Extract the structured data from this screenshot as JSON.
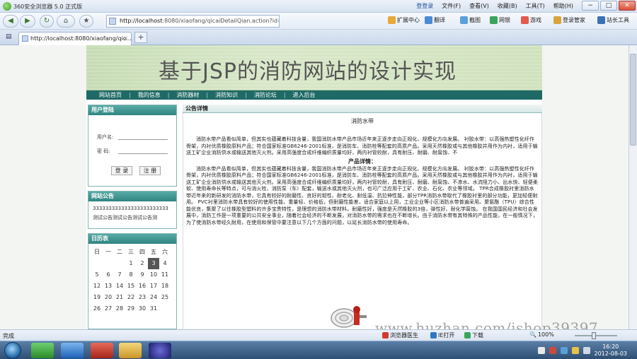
{
  "browser": {
    "app_title": "360安全浏览器 5.0 正式版",
    "menu": [
      "文件(F)",
      "查看(V)",
      "收藏(B)",
      "工具(T)",
      "帮助(H)"
    ],
    "login_link": "登登录",
    "window_controls": [
      "−",
      "□",
      "✕"
    ]
  },
  "nav": {
    "back": "◀",
    "forward": "▶",
    "refresh": "↻",
    "home": "⌂",
    "fav": "★",
    "address_host": "http://localhost",
    "address_rest": ":8080/xiaofang/qicaiDetailQian.action?id=4",
    "toolbar": [
      "扩展中心",
      "翻译",
      "截图",
      "网银",
      "游戏",
      "登录管家",
      "站长工具"
    ]
  },
  "tab": {
    "label": "http://localhost:8080/xiaofang/qic...",
    "close": "×",
    "new": "+"
  },
  "site": {
    "banner_title": "基于JSP的消防网站的设计实现",
    "nav": [
      "网站首页",
      "我的信息",
      "消防器材",
      "消防知识",
      "消防论坛",
      "进入后台"
    ],
    "login": {
      "header": "用户登陆",
      "user_label": "用户名:",
      "pass_label": "密 码:",
      "login_btn": "登 录",
      "register_btn": "注 册"
    },
    "notice": {
      "header": "网站公告",
      "lines": [
        "333333333333333333333333",
        "测试公告测试公告测试公告测"
      ]
    },
    "calendar": {
      "header": "日历表",
      "weekdays": [
        "日",
        "一",
        "二",
        "三",
        "四",
        "五",
        "六"
      ],
      "days": [
        "",
        "",
        "",
        "",
        "",
        "",
        "",
        "",
        "",
        "",
        "1",
        "2",
        "3",
        "4",
        "5",
        "6",
        "7",
        "8",
        "9",
        "10",
        "11",
        "12",
        "13",
        "14",
        "15",
        "16",
        "17",
        "18",
        "19",
        "20",
        "21",
        "22",
        "23",
        "24",
        "25",
        "26",
        "27",
        "28",
        "29",
        "30",
        "31",
        "",
        ""
      ],
      "today": "3"
    },
    "main": {
      "header": "公告详情",
      "article_title": "消防水带",
      "para1": "消防水带产品看似简单，但其实也蕴藏着科技含量，我国消防水带产品市场近年来正逐步走向正规化、规模化方向发展。 衬胶水带：以高强热塑性化纤作骨架，内衬优质橡胶原料产品；符合国家标准GB6246-2001标准，是消防车、消防栓等配套的高质产品。采用天然橡胶或与其他橡胶并用作为内衬，适用于输送工矿企业消防供水或输送其他灭火剂。采用高强度合成纤维编织质量均好，两内衬管较耐，具有耐压、耐磨、耐腐蚀、不",
      "subhead": "产品详情：",
      "para2": "消防水带产品看似简单，但其实也蕴藏着科技含量，我国消防水带产品市场近年来正逐步走向正规化、规模化方向发展。 衬胶水带：以高强热塑性化纤作骨架，内衬优质橡胶原料产品；符合国家标准GB6246-2001标准，是消防车、消防栓等配套的高质产品。采用天然橡胶或与其他橡胶并用作为内衬，适用于输送工矿企业消防供水或输送其他灭火剂。采用高强度合成纤维编织质量均好，两内衬管较耐，具有耐压、耐磨、耐腐蚀、不渗水、水流阻力小、出水快、轻便柔软、使用寿命长等特点，可与消火栓、消防泵（车）配套，输送水或其他灭火剂，也可广泛应用于工矿、农业、石化、农业等领域。 TPR合成橡胶衬里消防水带近年来的新研发的消防水带，它具有较好的耐磨性、良好的韧性、耐老化、耐低温、抗拉伸性能，部分TPR消防水带取代了橡胶衬里的部分功能，更加轻便耐用。 PVC衬里消防水带具有较好的使用性能、重量轻、价格低，但耐磨性能差，适合家庭以上用，工业企业等小区消防水带普遍采用。聚氨酯（TPU）综合性能优良，集聚了以往橡胶型塑料的许多宝贵特性，是理想的消防水带材料。耐磨性好，强度是天然橡胶的3倍，弹性好、耐化学腐蚀。 在我国国民经济和社会发展中，消防工作是一项重要的公共安全事业，随着社会经济的不断发展，对消防水带的需求也在不断增长。由于消防水带有其特殊的产品性能，在一般情况下，为了使消防水带经久耐用，在使用和保管中要注意以下几个方面的问题，以延长消防水带的使用寿命。"
    }
  },
  "watermark": "www.huzhan.com/ishop39397",
  "status": {
    "done": "完成",
    "items": [
      "浏览器医生",
      "IE打开",
      "下载"
    ],
    "zoom": "100%"
  },
  "taskbar": {
    "time": "16:20",
    "date": "2012-08-03"
  },
  "colors": {
    "site_nav": "#1f6a66",
    "panel_header": "#2f8581",
    "banner": "#d0e2bd"
  }
}
